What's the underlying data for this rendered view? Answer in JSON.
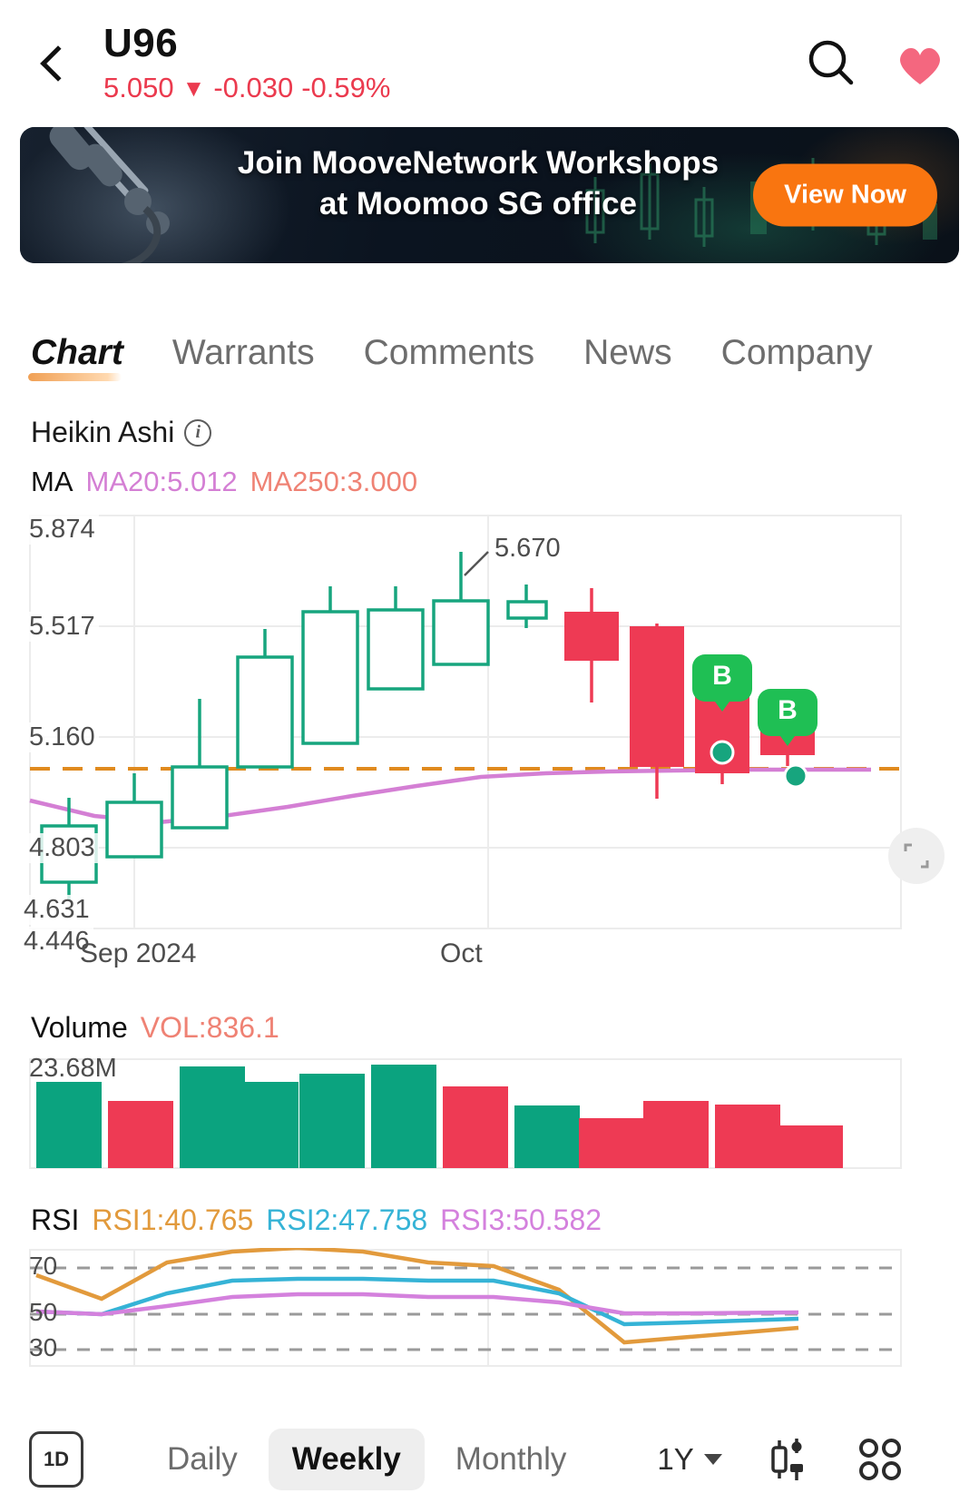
{
  "header": {
    "back_icon": "chevron-left-icon",
    "ticker": "U96",
    "price": "5.050",
    "change_arrow": "▼",
    "change_abs": "-0.030",
    "change_pct": "-0.59%",
    "change_color": "#eb3a4e",
    "search_icon": "search-icon",
    "favorite_icon": "heart-icon",
    "favorite_color": "#f4677f"
  },
  "banner": {
    "line1": "Join MooveNetwork Workshops",
    "line2": "at Moomoo SG office",
    "cta_label": "View Now",
    "cta_color": "#f97510"
  },
  "tabs": [
    {
      "label": "Chart",
      "active": true
    },
    {
      "label": "Warrants",
      "active": false
    },
    {
      "label": "Comments",
      "active": false
    },
    {
      "label": "News",
      "active": false
    },
    {
      "label": "Company",
      "active": false
    }
  ],
  "chart_header": {
    "style_label": "Heikin Ashi",
    "info_icon": "info-icon",
    "ma_label": "MA",
    "ma20_text": "MA20:5.012",
    "ma250_text": "MA250:3.000",
    "ma20_color": "#d47fd4",
    "ma250_color": "#ef8274"
  },
  "chart_data": {
    "type": "candlestick",
    "title": "U96 Weekly Heikin Ashi",
    "y_ticks": [
      "5.874",
      "5.517",
      "5.160",
      "4.803",
      "4.631",
      "4.446"
    ],
    "ylim": [
      4.446,
      5.874
    ],
    "x_ticks": [
      "Sep 2024",
      "Oct"
    ],
    "annotation": {
      "label": "5.670",
      "value": 5.67
    },
    "ref_line": {
      "value": 5.05,
      "color": "#e08a1e",
      "style": "dashed"
    },
    "up_color": "#17a57e",
    "down_color": "#ee3a54",
    "candles": [
      {
        "open": 4.845,
        "high": 4.92,
        "low": 4.63,
        "close": 4.74,
        "dir": "up"
      },
      {
        "open": 4.9,
        "high": 5.03,
        "low": 4.78,
        "close": 4.78,
        "dir": "up"
      },
      {
        "open": 5.02,
        "high": 5.19,
        "low": 4.9,
        "close": 4.9,
        "dir": "up"
      },
      {
        "open": 5.3,
        "high": 5.44,
        "low": 5.01,
        "close": 5.01,
        "dir": "up"
      },
      {
        "open": 5.47,
        "high": 5.62,
        "low": 5.14,
        "close": 5.14,
        "dir": "up"
      },
      {
        "open": 5.5,
        "high": 5.55,
        "low": 5.22,
        "close": 5.22,
        "dir": "up"
      },
      {
        "open": 5.53,
        "high": 5.67,
        "low": 5.4,
        "close": 5.4,
        "dir": "up"
      },
      {
        "open": 5.5,
        "high": 5.56,
        "low": 5.48,
        "close": 5.51,
        "dir": "up"
      },
      {
        "open": 5.49,
        "high": 5.56,
        "low": 5.13,
        "close": 5.37,
        "dir": "down"
      },
      {
        "open": 5.42,
        "high": 5.42,
        "low": 4.92,
        "close": 5.02,
        "dir": "down"
      },
      {
        "open": 5.26,
        "high": 5.26,
        "low": 4.93,
        "close": 5.0,
        "dir": "down"
      },
      {
        "open": 5.13,
        "high": 5.13,
        "low": 4.96,
        "close": 5.06,
        "dir": "down"
      }
    ],
    "ma20_line": [
      4.865,
      4.845,
      4.838,
      4.845,
      4.868,
      4.9,
      4.935,
      4.975,
      5.0,
      5.012,
      5.012,
      5.012
    ],
    "markers": [
      {
        "type": "buy",
        "label": "B",
        "candle_index": 10,
        "color": "#1fbf54"
      },
      {
        "type": "buy",
        "label": "B",
        "candle_index": 11,
        "color": "#1fbf54"
      }
    ]
  },
  "volume": {
    "label": "Volume",
    "value_text": "VOL:836.1",
    "value_color": "#ef8274",
    "max_label": "23.68M",
    "type": "bar",
    "up_color": "#0ba37f",
    "down_color": "#ee3a54",
    "values": [
      16.8,
      12.2,
      20.5,
      17.4,
      19.4,
      21.5,
      16.1,
      11.6,
      9.4,
      12.6,
      12.1,
      8.2
    ],
    "dirs": [
      "up",
      "down",
      "up",
      "up",
      "up",
      "up",
      "down",
      "up",
      "down",
      "down",
      "down",
      "down"
    ]
  },
  "rsi": {
    "label": "RSI",
    "rsi1_text": "RSI1:40.765",
    "rsi2_text": "RSI2:47.758",
    "rsi3_text": "RSI3:50.582",
    "rsi1_color": "#e29a3c",
    "rsi2_color": "#35b3d6",
    "rsi3_color": "#d481dd",
    "y_ticks": [
      "70",
      "50",
      "30"
    ],
    "ylim": [
      20,
      85
    ],
    "series": [
      {
        "name": "RSI1",
        "values": [
          68,
          58,
          72,
          78,
          80,
          78,
          72,
          71,
          62,
          36,
          38,
          40.765
        ]
      },
      {
        "name": "RSI2",
        "values": [
          51,
          50,
          58,
          63,
          64,
          64,
          63,
          63,
          58,
          45,
          46,
          47.758
        ]
      },
      {
        "name": "RSI3",
        "values": [
          51,
          50,
          53,
          56,
          57,
          57,
          56,
          56,
          54,
          50,
          50,
          50.582
        ]
      }
    ]
  },
  "bottom_bar": {
    "interval_badge": "1D",
    "timeframes": [
      {
        "label": "Daily",
        "active": false
      },
      {
        "label": "Weekly",
        "active": true
      },
      {
        "label": "Monthly",
        "active": false
      }
    ],
    "range_label": "1Y",
    "chart_type_icon": "candlestick-icon",
    "more_icon": "grid-icon"
  }
}
